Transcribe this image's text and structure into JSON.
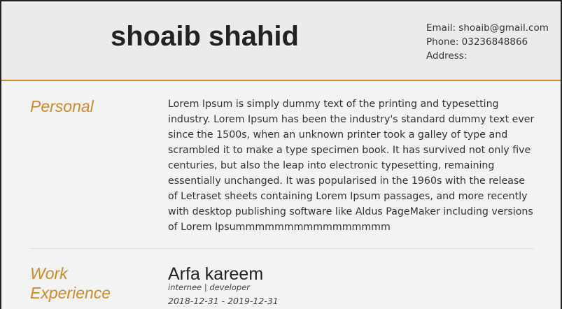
{
  "header": {
    "name": "shoaib shahid",
    "contact": {
      "email_line": "Email: shoaib@gmail.com",
      "phone_line": "Phone: 03236848866",
      "address_line": "Address:"
    }
  },
  "personal": {
    "title": "Personal",
    "text": "Lorem Ipsum is simply dummy text of the printing and typesetting industry. Lorem Ipsum has been the industry's standard dummy text ever since the 1500s, when an unknown printer took a galley of type and scrambled it to make a type specimen book. It has survived not only five centuries, but also the leap into electronic typesetting, remaining essentially unchanged. It was popularised in the 1960s with the release of Letraset sheets containing Lorem Ipsum passages, and more recently with desktop publishing software like Aldus PageMaker including versions of Lorem Ipsummmmmmmmmmmmmmmm"
  },
  "work_experience": {
    "title": "Work Experience",
    "entries": [
      {
        "company": "Arfa kareem",
        "role": "internee | developer",
        "dates": "2018-12-31 - 2019-12-31"
      }
    ]
  },
  "colors": {
    "accent": "#cf8a2a",
    "header_bg": "#ebebeb",
    "page_bg": "#f3f3f3",
    "text": "#333333"
  }
}
